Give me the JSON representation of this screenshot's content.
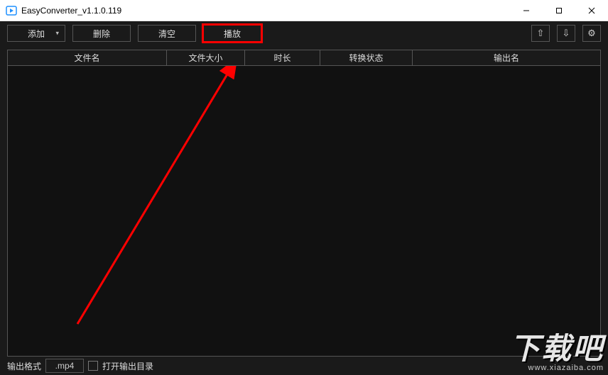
{
  "window": {
    "title": "EasyConverter_v1.1.0.119"
  },
  "toolbar": {
    "add_label": "添加",
    "delete_label": "删除",
    "clear_label": "清空",
    "play_label": "播放"
  },
  "icons": {
    "move_up": "⇧",
    "move_down": "⇩",
    "settings": "⚙"
  },
  "table": {
    "headers": {
      "filename": "文件名",
      "filesize": "文件大小",
      "duration": "时长",
      "status": "转换状态",
      "output": "输出名"
    },
    "rows": []
  },
  "footer": {
    "output_format_label": "输出格式",
    "output_format_value": ".mp4",
    "open_output_dir_label": "打开输出目录"
  },
  "watermark": {
    "text_main": "下载吧",
    "text_sub": "www.xiazaiba.com"
  }
}
